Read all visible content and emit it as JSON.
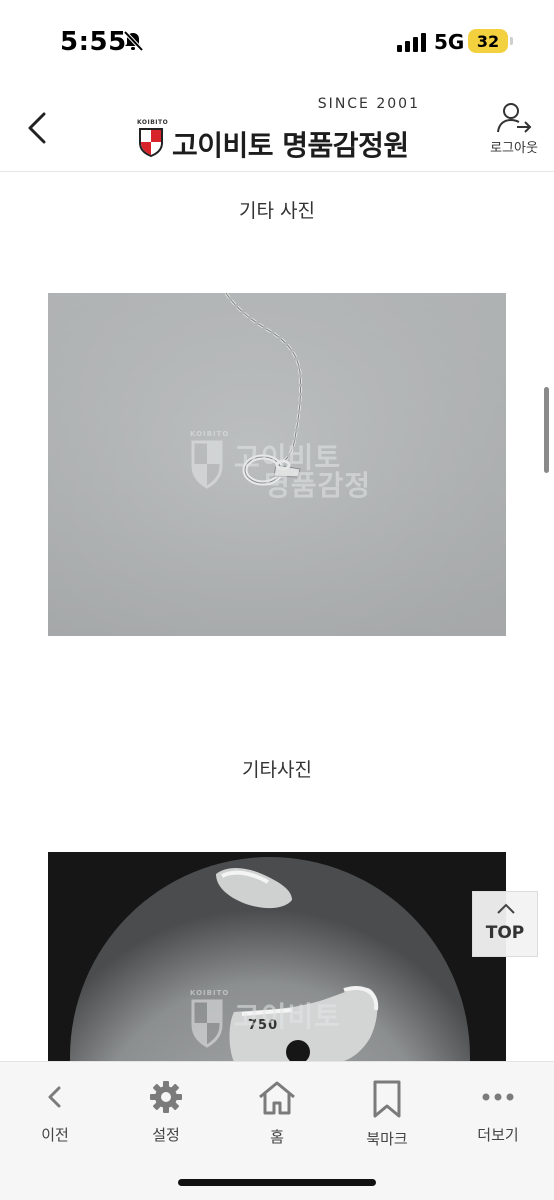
{
  "status_bar": {
    "time": "5:55",
    "network": "5G",
    "battery": "32"
  },
  "header": {
    "since": "SINCE 2001",
    "koibito": "KOIBITO",
    "brand": "고이비토 명품감정원",
    "logout_label": "로그아웃"
  },
  "content": {
    "sections": [
      {
        "caption": "기타 사진"
      },
      {
        "caption": "기타사진"
      }
    ],
    "watermark": {
      "koibito": "KOIBITO",
      "line1": "고이비토",
      "line2": "명품감정",
      "stamp": "750"
    }
  },
  "top_button": {
    "label": "TOP"
  },
  "bottom_nav": {
    "items": [
      {
        "label": "이전",
        "icon": "chevron-left-icon"
      },
      {
        "label": "설정",
        "icon": "gear-icon"
      },
      {
        "label": "홈",
        "icon": "home-icon"
      },
      {
        "label": "북마크",
        "icon": "bookmark-icon"
      },
      {
        "label": "더보기",
        "icon": "more-dots-icon"
      }
    ]
  },
  "colors": {
    "brand_red": "#d9232b",
    "battery_yellow": "#f3d03e",
    "icon_gray": "#7b7b7b"
  }
}
